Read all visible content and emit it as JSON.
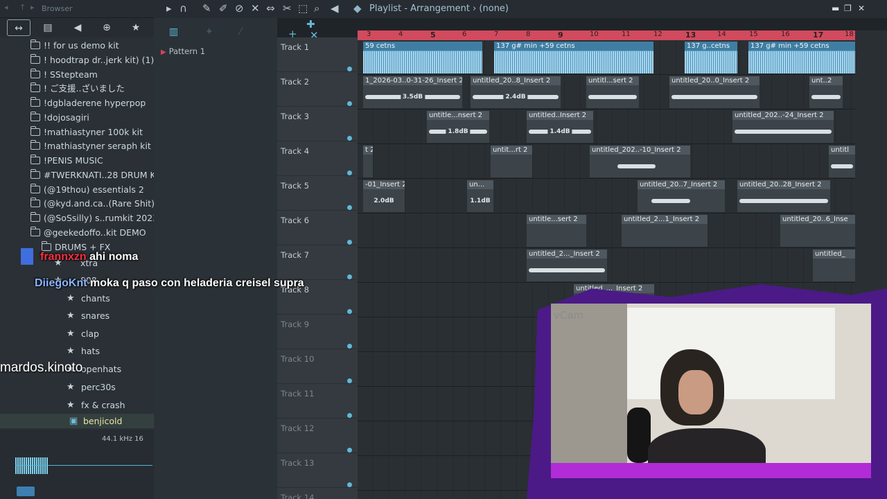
{
  "browser": {
    "title": "Browser",
    "items": [
      "!! for us demo kit",
      "! hoodtrap dr..jerk kit) (1)",
      "! SStepteam",
      "! ご支援..ざいました",
      "!dgbladerene hyperpop",
      "!dojosagiri",
      "!mathiastyner 100k kit",
      "!mathiastyner seraph kit",
      "!PENIS MUSIC",
      "#TWERKNATI..28 DRUM KIT",
      "(@19thou) essentials 2",
      "(@kyd.and.ca..(Rare Shit)",
      "(@SoSsilly) s..rumkit 2023",
      "@geekedoffo..kit DEMO"
    ],
    "sub_items": [
      "DRUMS + FX",
      "xtra",
      "808",
      "chants",
      "snares",
      "clap",
      "hats",
      "openhats",
      "perc30s",
      "fx & crash",
      "benjicold"
    ],
    "sample_rate": "44.1 kHz 16"
  },
  "pattern": {
    "name": "Pattern 1"
  },
  "toolbar": {
    "title": "Playlist - Arrangement › (none)"
  },
  "ruler": [
    "3",
    "4",
    "5",
    "6",
    "7",
    "8",
    "9",
    "10",
    "11",
    "12",
    "13",
    "14",
    "15",
    "16",
    "17",
    "18"
  ],
  "tracks": [
    "Track 1",
    "Track 2",
    "Track 3",
    "Track 4",
    "Track 5",
    "Track 6",
    "Track 7",
    "Track 8",
    "Track 9",
    "Track 10",
    "Track 11",
    "Track 12",
    "Track 13",
    "Track 14"
  ],
  "clips": {
    "t1": [
      "59 cetns",
      "137 g# min +59 cetns",
      "137 g..cetns",
      "137 g# min +59 cetns"
    ],
    "t2": [
      "1_2026-03..0-31-26_Insert 2",
      "untitled_20..8_Insert 2",
      "untitl...sert 2",
      "untitled_20..0_Insert 2",
      "unt..2"
    ],
    "t3": [
      "untitle...nsert 2",
      "untitled..Insert 2",
      "untitled_202..-24_Insert 2"
    ],
    "t4": [
      "t 2",
      "untit...rt 2",
      "untitled_202..-10_Insert 2",
      "untitl"
    ],
    "t5": [
      "-01_Insert 2",
      "un...",
      "untitled_20..7_Insert 2",
      "untitled_20..28_Insert 2"
    ],
    "t6": [
      "untitle...sert 2",
      "untitled_2...1_Insert 2",
      "untitled_20..6_Inse"
    ],
    "t7": [
      "untitled_2..._Insert 2",
      "untitled_"
    ],
    "t8": [
      "untitled_..._Insert 2"
    ]
  },
  "gains": {
    "g1": "3.5dB",
    "g2": "2.4dB",
    "g3": "1.8dB",
    "g4": "1.4dB",
    "g5": "2.0dB",
    "g6": "1.1dB"
  },
  "overlay": {
    "chat1_user": "frannxzn",
    "chat1_msg": "ahi noma",
    "chat2_user": "DiiegoKnt",
    "chat2_msg": "moka q paso con heladeria creisel supra",
    "watermark": "mardos.kinoto",
    "cam_label": "vCam"
  },
  "icons": [
    "play-icon",
    "magnet-icon",
    "pencil-icon",
    "brush-icon",
    "delete-icon",
    "mute-icon",
    "slip-icon",
    "select-icon",
    "zoom-icon",
    "speaker-icon",
    "star-icon",
    "folder-icon"
  ]
}
